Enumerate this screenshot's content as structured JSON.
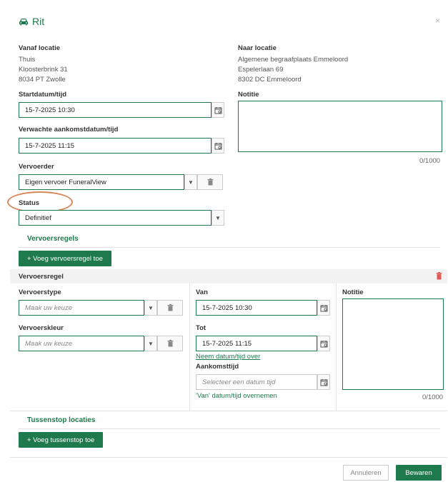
{
  "dialog": {
    "title": "Rit",
    "close": "×"
  },
  "from": {
    "label": "Vanaf locatie",
    "name": "Thuis",
    "street": "Kloosterbrink 31",
    "city": "8034 PT Zwolle"
  },
  "to": {
    "label": "Naar locatie",
    "name": "Algemene begraafplaats Emmeloord",
    "street": "Espelerlaan 69",
    "city": "8302 DC Emmeloord"
  },
  "start": {
    "label": "Startdatum/tijd",
    "value": "15-7-2025 10:30"
  },
  "note": {
    "label": "Notitie",
    "counter": "0/1000"
  },
  "arrival": {
    "label": "Verwachte aankomstdatum/tijd",
    "value": "15-7-2025 11:15"
  },
  "carrier": {
    "label": "Vervoerder",
    "value": "Eigen vervoer FuneralView"
  },
  "status": {
    "label": "Status",
    "value": "Definitief"
  },
  "transport_rules": {
    "title": "Vervoersregels",
    "add_button": "+ Voeg vervoersregel toe"
  },
  "rule": {
    "header": "Vervoersregel",
    "type_label": "Vervoerstype",
    "type_placeholder": "Maak uw keuze",
    "color_label": "Vervoerskleur",
    "color_placeholder": "Maak uw keuze",
    "from_label": "Van",
    "from_value": "15-7-2025 10:30",
    "to_label": "Tot",
    "to_value": "15-7-2025 11:15",
    "copy_link": "Neem datum/tijd over",
    "arrival_label": "Aankomsttijd",
    "arrival_placeholder": "Selecteer een datum tijd",
    "copy_from_link": "'Van' datum/tijd overnemen",
    "note_label": "Notitie",
    "note_counter": "0/1000"
  },
  "stops": {
    "title": "Tussenstop locaties",
    "add_button": "+ Voeg tussenstop toe"
  },
  "footer": {
    "cancel": "Annuleren",
    "save": "Bewaren"
  },
  "colors": {
    "accent": "#1e7a4c",
    "delete": "#e05a5a",
    "highlight": "#d9865a"
  }
}
